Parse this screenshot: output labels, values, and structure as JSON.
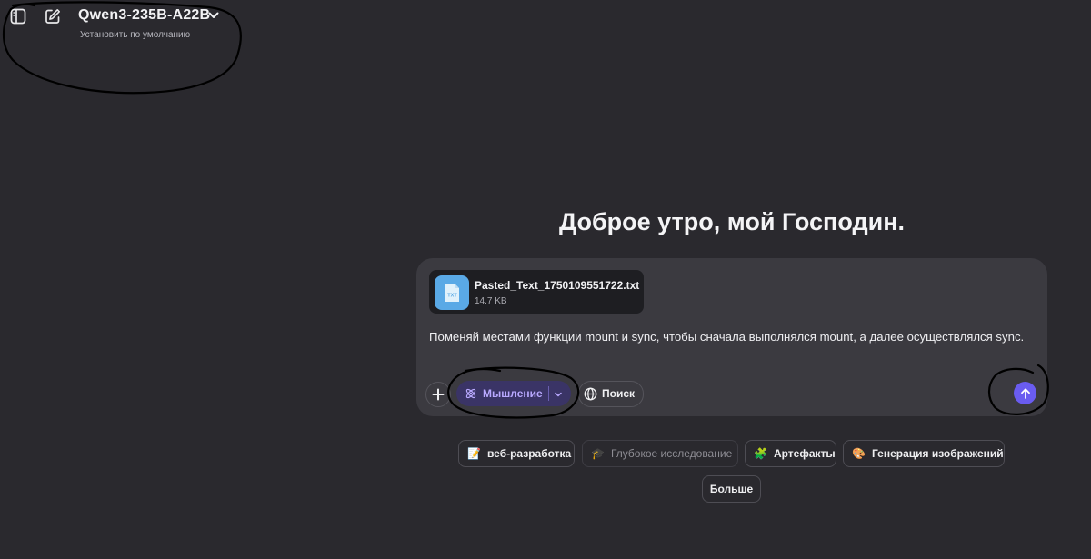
{
  "header": {
    "model_name": "Qwen3-235B-A22B",
    "set_default": "Установить по умолчанию"
  },
  "greeting": "Доброе утро, мой Господин.",
  "composer": {
    "attachment": {
      "name": "Pasted_Text_1750109551722.txt",
      "size": "14.7 KB",
      "badge": "TXT"
    },
    "message": "Поменяй местами функции mount и sync, чтобы сначала выполнялся mount, а далее осуществлялся sync.",
    "thinking_label": "Мышление",
    "search_label": "Поиск"
  },
  "suggestions": [
    {
      "icon": "📝",
      "label": "веб-разработка"
    },
    {
      "icon": "🎓",
      "label": "Глубокое исследование"
    },
    {
      "icon": "🧩",
      "label": "Артефакты"
    },
    {
      "icon": "🎨",
      "label": "Генерация изображений"
    }
  ],
  "more_label": "Больше",
  "colors": {
    "background": "#2a292e",
    "composer": "#3b3a40",
    "accent": "#6a5cf0",
    "thinking_bg": "#3a3466",
    "thinking_text": "#b9a9ff"
  }
}
